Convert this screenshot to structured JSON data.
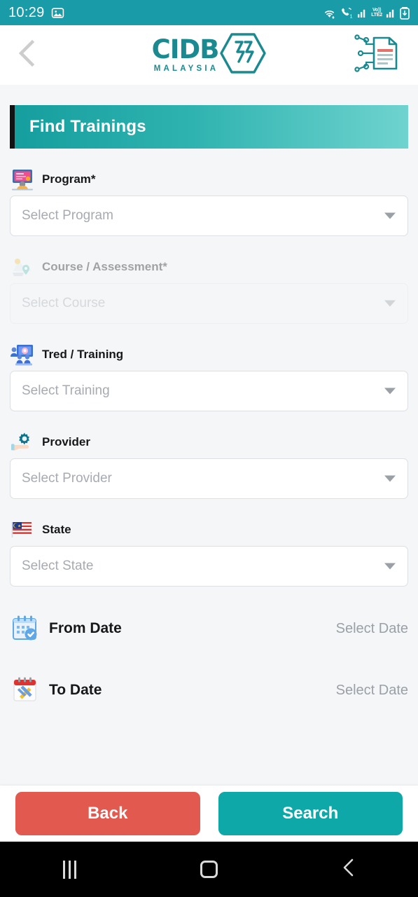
{
  "status_bar": {
    "time": "10:29",
    "left_icons": [
      "image-icon"
    ],
    "right_icons": [
      "wifi-icon",
      "call-icon",
      "signal-icon",
      "volte-icon",
      "signal2-icon",
      "battery-icon"
    ],
    "volte_line1": "Vo))",
    "volte_line2": "LTE2",
    "call_badge": "1",
    "background": "#1a9ba8"
  },
  "header": {
    "back_icon": "chevron-left-icon",
    "logo_primary": "CIDB",
    "logo_secondary": "MALAYSIA",
    "logo_color": "#1b8a90",
    "right_icon": "cims-document-icon"
  },
  "banner": {
    "title": "Find Trainings",
    "gradient_from": "#159e9e",
    "gradient_to": "#6fd3cf",
    "accent_bar": "#111214"
  },
  "fields": [
    {
      "label": "Program*",
      "placeholder": "Select Program",
      "icon": "online-learning-icon",
      "disabled": false
    },
    {
      "label": "Course / Assessment*",
      "placeholder": "Select Course",
      "icon": "course-location-icon",
      "disabled": true
    },
    {
      "label": "Tred / Training",
      "placeholder": "Select Training",
      "icon": "classroom-icon",
      "disabled": false
    },
    {
      "label": "Provider",
      "placeholder": "Select Provider",
      "icon": "gear-hand-icon",
      "disabled": false
    },
    {
      "label": "State",
      "placeholder": "Select State",
      "icon": "malaysia-flag-icon",
      "disabled": false
    }
  ],
  "date_rows": [
    {
      "label": "From Date",
      "value": "Select Date",
      "icon": "calendar-check-icon"
    },
    {
      "label": "To Date",
      "value": "Select Date",
      "icon": "calendar-edit-icon"
    }
  ],
  "actions": {
    "back_label": "Back",
    "back_color": "#e2594f",
    "search_label": "Search",
    "search_color": "#0fa8a8"
  },
  "navigation_bar": {
    "recents_icon": "recents-icon",
    "home_icon": "home-icon",
    "back_icon": "nav-back-icon"
  }
}
